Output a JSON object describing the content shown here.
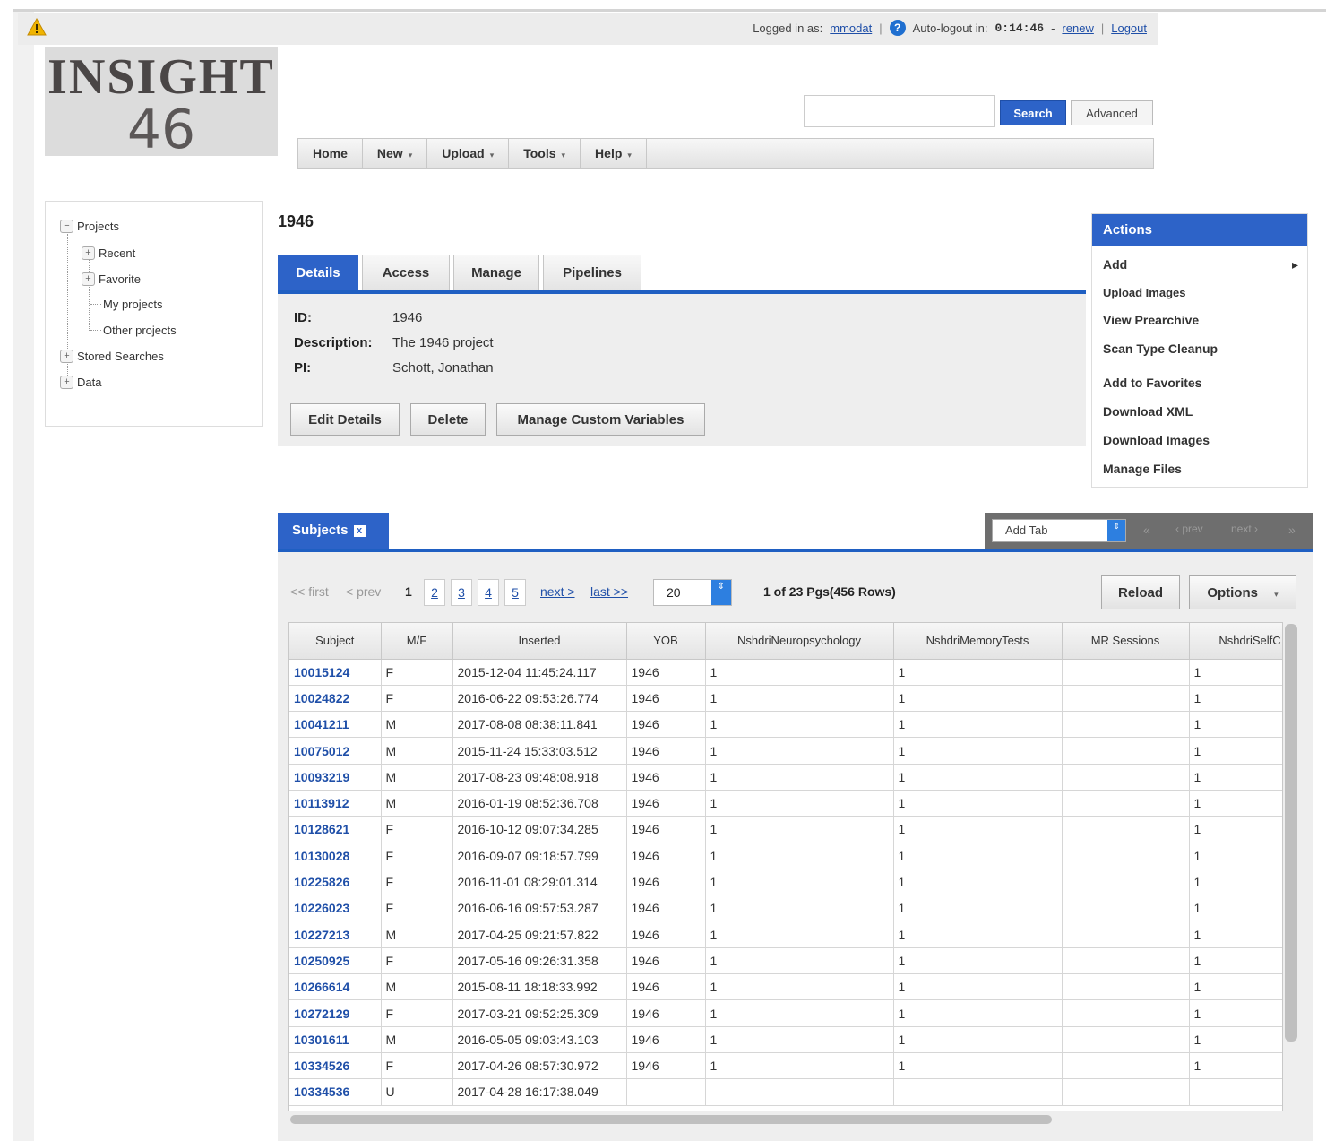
{
  "topbar": {
    "logged_in_label": "Logged in as:",
    "username": "mmodat",
    "autologout_label": "Auto-logout in:",
    "timer": "0:14:46",
    "renew": "renew",
    "logout": "Logout",
    "separator": "|",
    "dash": "-",
    "help_glyph": "?"
  },
  "logo": {
    "line1": "INSIGHT",
    "line2": "46"
  },
  "search": {
    "value": "",
    "button": "Search",
    "advanced": "Advanced"
  },
  "nav": [
    "Home",
    "New",
    "Upload",
    "Tools",
    "Help"
  ],
  "nav_caret": "▾",
  "tree": {
    "projects": "Projects",
    "recent": "Recent",
    "favorite": "Favorite",
    "my_projects": "My projects",
    "other_projects": "Other projects",
    "stored_searches": "Stored Searches",
    "data": "Data",
    "expand_glyph": "+",
    "collapse_glyph": "−"
  },
  "project": {
    "title": "1946",
    "tabs": [
      "Details",
      "Access",
      "Manage",
      "Pipelines"
    ],
    "fields": {
      "id_label": "ID:",
      "id_value": "1946",
      "desc_label": "Description:",
      "desc_value": "The 1946 project",
      "pi_label": "PI:",
      "pi_value": "Schott, Jonathan"
    },
    "buttons": {
      "edit": "Edit Details",
      "delete": "Delete",
      "custom_vars": "Manage Custom Variables"
    }
  },
  "actions": {
    "title": "Actions",
    "add": "Add",
    "add_arrow": "▸",
    "upload_images": "Upload Images",
    "view_prearchive": "View Prearchive",
    "scan_type_cleanup": "Scan Type Cleanup",
    "add_favorites": "Add to Favorites",
    "download_xml": "Download XML",
    "download_images": "Download Images",
    "manage_files": "Manage Files"
  },
  "subjects": {
    "tab_label": "Subjects",
    "close_glyph": "x",
    "add_tab": "Add Tab",
    "spin_glyph": "⇕",
    "nav_first": "«",
    "nav_prev": "‹ prev",
    "nav_next": "next ›",
    "nav_last": "»",
    "pager": {
      "first": "<< first",
      "prev": "< prev",
      "current": "1",
      "pages": [
        "2",
        "3",
        "4",
        "5"
      ],
      "next": "next >",
      "last": "last >>",
      "rows_per_page": "20",
      "count": "1 of 23 Pgs(456 Rows)"
    },
    "reload": "Reload",
    "options": "Options",
    "options_caret": "▾",
    "columns": [
      "Subject",
      "M/F",
      "Inserted",
      "YOB",
      "NshdriNeuropsychology",
      "NshdriMemoryTests",
      "MR Sessions",
      "NshdriSelfC"
    ],
    "rows": [
      [
        "10015124",
        "F",
        "2015-12-04 11:45:24.117",
        "1946",
        "1",
        "1",
        "",
        "1"
      ],
      [
        "10024822",
        "F",
        "2016-06-22 09:53:26.774",
        "1946",
        "1",
        "1",
        "",
        "1"
      ],
      [
        "10041211",
        "M",
        "2017-08-08 08:38:11.841",
        "1946",
        "1",
        "1",
        "",
        "1"
      ],
      [
        "10075012",
        "M",
        "2015-11-24 15:33:03.512",
        "1946",
        "1",
        "1",
        "",
        "1"
      ],
      [
        "10093219",
        "M",
        "2017-08-23 09:48:08.918",
        "1946",
        "1",
        "1",
        "",
        "1"
      ],
      [
        "10113912",
        "M",
        "2016-01-19 08:52:36.708",
        "1946",
        "1",
        "1",
        "",
        "1"
      ],
      [
        "10128621",
        "F",
        "2016-10-12 09:07:34.285",
        "1946",
        "1",
        "1",
        "",
        "1"
      ],
      [
        "10130028",
        "F",
        "2016-09-07 09:18:57.799",
        "1946",
        "1",
        "1",
        "",
        "1"
      ],
      [
        "10225826",
        "F",
        "2016-11-01 08:29:01.314",
        "1946",
        "1",
        "1",
        "",
        "1"
      ],
      [
        "10226023",
        "F",
        "2016-06-16 09:57:53.287",
        "1946",
        "1",
        "1",
        "",
        "1"
      ],
      [
        "10227213",
        "M",
        "2017-04-25 09:21:57.822",
        "1946",
        "1",
        "1",
        "",
        "1"
      ],
      [
        "10250925",
        "F",
        "2017-05-16 09:26:31.358",
        "1946",
        "1",
        "1",
        "",
        "1"
      ],
      [
        "10266614",
        "M",
        "2015-08-11 18:18:33.992",
        "1946",
        "1",
        "1",
        "",
        "1"
      ],
      [
        "10272129",
        "F",
        "2017-03-21 09:52:25.309",
        "1946",
        "1",
        "1",
        "",
        "1"
      ],
      [
        "10301611",
        "M",
        "2016-05-05 09:03:43.103",
        "1946",
        "1",
        "1",
        "",
        "1"
      ],
      [
        "10334526",
        "F",
        "2017-04-26 08:57:30.972",
        "1946",
        "1",
        "1",
        "",
        "1"
      ],
      [
        "10334536",
        "U",
        "2017-04-28 16:17:38.049",
        "",
        "",
        "",
        "",
        ""
      ]
    ]
  },
  "colors": {
    "accent": "#2d63c8",
    "link": "#1f4fa8",
    "panel": "#eeeeee",
    "warning": "#f0b400"
  }
}
